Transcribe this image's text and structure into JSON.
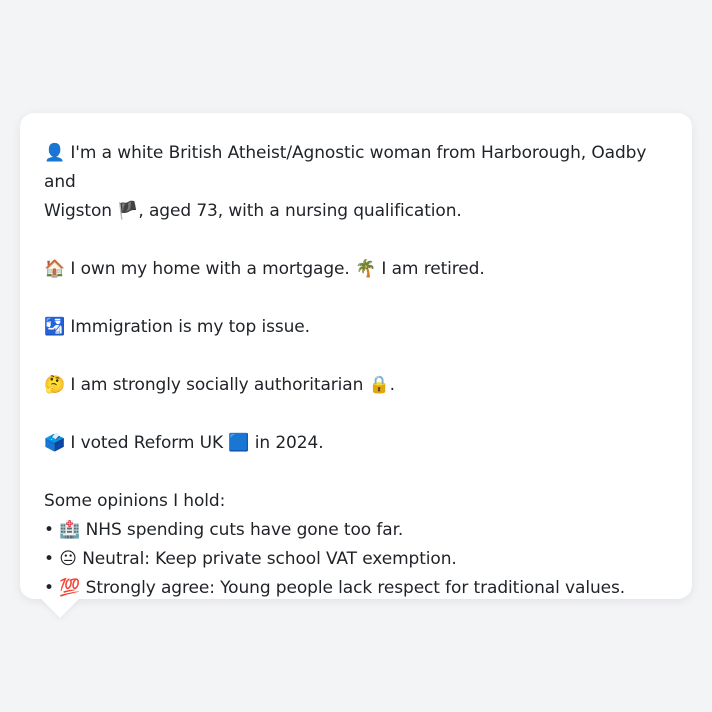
{
  "profile": {
    "intro": {
      "icon": "👤",
      "text_line1": "I'm a white British Atheist/Agnostic woman from Harborough, Oadby and",
      "text_line2_a": "Wigston",
      "flag": "🏴",
      "text_line2_b": ", aged 73, with a nursing qualification."
    },
    "home": {
      "icon": "🏠",
      "text_a": "I own my home with a mortgage.",
      "icon2": "🌴",
      "text_b": "I am retired."
    },
    "issue": {
      "icon": "🛂",
      "text": "Immigration is my top issue."
    },
    "stance": {
      "icon": "🤔",
      "text": "I am strongly socially authoritarian",
      "icon2": "🔒",
      "suffix": "."
    },
    "vote": {
      "icon": "🗳️",
      "text_a": "I voted Reform UK",
      "icon2": "🟦",
      "text_b": "in 2024."
    },
    "opinions_header": "Some opinions I hold:",
    "opinions": [
      {
        "bullet": "•",
        "icon": "🏥",
        "text": "NHS spending cuts have gone too far."
      },
      {
        "bullet": "•",
        "icon": "😐",
        "text": "Neutral: Keep private school VAT exemption."
      },
      {
        "bullet": "•",
        "icon": "💯",
        "text": "Strongly agree: Young people lack respect for traditional values."
      }
    ]
  }
}
